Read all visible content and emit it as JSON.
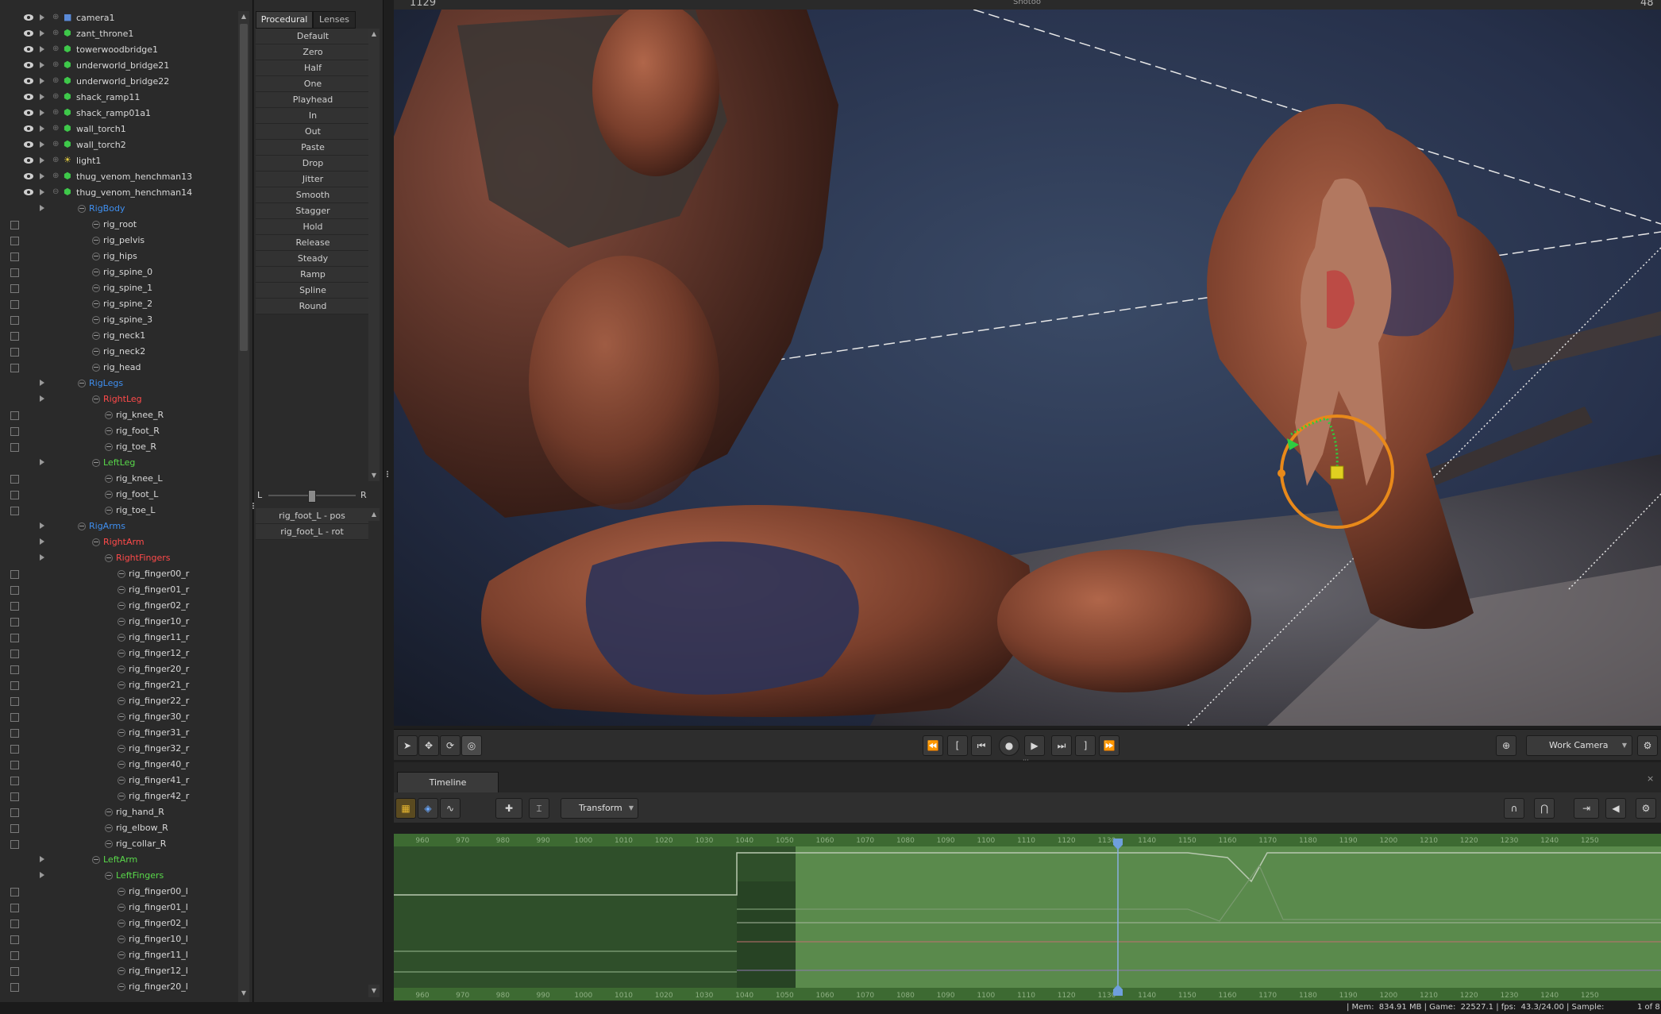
{
  "viewport": {
    "frame_left": "1129",
    "camera_name": "Shotoo",
    "frame_right": "48"
  },
  "outliner": {
    "rows": [
      {
        "label": "camera1",
        "kind": "camera",
        "indent": 0,
        "visible": true
      },
      {
        "label": "zant_throne1",
        "kind": "mesh",
        "indent": 0,
        "visible": true
      },
      {
        "label": "towerwoodbridge1",
        "kind": "mesh",
        "indent": 0,
        "visible": true
      },
      {
        "label": "underworld_bridge21",
        "kind": "mesh",
        "indent": 0,
        "visible": true
      },
      {
        "label": "underworld_bridge22",
        "kind": "mesh",
        "indent": 0,
        "visible": true
      },
      {
        "label": "shack_ramp11",
        "kind": "mesh",
        "indent": 0,
        "visible": true
      },
      {
        "label": "shack_ramp01a1",
        "kind": "mesh",
        "indent": 0,
        "visible": true
      },
      {
        "label": "wall_torch1",
        "kind": "mesh",
        "indent": 0,
        "visible": true
      },
      {
        "label": "wall_torch2",
        "kind": "mesh",
        "indent": 0,
        "visible": true
      },
      {
        "label": "light1",
        "kind": "light",
        "indent": 0,
        "visible": true
      },
      {
        "label": "thug_venom_henchman13",
        "kind": "mesh",
        "indent": 0,
        "visible": true
      },
      {
        "label": "thug_venom_henchman14",
        "kind": "mesh",
        "indent": 0,
        "visible": true,
        "expanded": true
      },
      {
        "label": "RigBody",
        "kind": "group",
        "color": "blue",
        "indent": 1,
        "arrow": true
      },
      {
        "label": "rig_root",
        "kind": "joint",
        "indent": 2,
        "check": true
      },
      {
        "label": "rig_pelvis",
        "kind": "joint",
        "indent": 2,
        "check": true
      },
      {
        "label": "rig_hips",
        "kind": "joint",
        "indent": 2,
        "check": true
      },
      {
        "label": "rig_spine_0",
        "kind": "joint",
        "indent": 2,
        "check": true
      },
      {
        "label": "rig_spine_1",
        "kind": "joint",
        "indent": 2,
        "check": true
      },
      {
        "label": "rig_spine_2",
        "kind": "joint",
        "indent": 2,
        "check": true
      },
      {
        "label": "rig_spine_3",
        "kind": "joint",
        "indent": 2,
        "check": true
      },
      {
        "label": "rig_neck1",
        "kind": "joint",
        "indent": 2,
        "check": true
      },
      {
        "label": "rig_neck2",
        "kind": "joint",
        "indent": 2,
        "check": true
      },
      {
        "label": "rig_head",
        "kind": "joint",
        "indent": 2,
        "check": true
      },
      {
        "label": "RigLegs",
        "kind": "group",
        "color": "blue",
        "indent": 1,
        "arrow": true
      },
      {
        "label": "RightLeg",
        "kind": "group",
        "color": "red",
        "indent": 2,
        "arrow": true
      },
      {
        "label": "rig_knee_R",
        "kind": "joint",
        "indent": 3,
        "check": true
      },
      {
        "label": "rig_foot_R",
        "kind": "joint",
        "indent": 3,
        "check": true
      },
      {
        "label": "rig_toe_R",
        "kind": "joint",
        "indent": 3,
        "check": true
      },
      {
        "label": "LeftLeg",
        "kind": "group",
        "color": "green",
        "indent": 2,
        "arrow": true
      },
      {
        "label": "rig_knee_L",
        "kind": "joint",
        "indent": 3,
        "check": true
      },
      {
        "label": "rig_foot_L",
        "kind": "joint",
        "indent": 3,
        "check": true
      },
      {
        "label": "rig_toe_L",
        "kind": "joint",
        "indent": 3,
        "check": true
      },
      {
        "label": "RigArms",
        "kind": "group",
        "color": "blue",
        "indent": 1,
        "arrow": true
      },
      {
        "label": "RightArm",
        "kind": "group",
        "color": "red",
        "indent": 2,
        "arrow": true
      },
      {
        "label": "RightFingers",
        "kind": "group",
        "color": "red",
        "indent": 3,
        "arrow": true
      },
      {
        "label": "rig_finger00_r",
        "kind": "joint",
        "indent": 4,
        "check": true
      },
      {
        "label": "rig_finger01_r",
        "kind": "joint",
        "indent": 4,
        "check": true
      },
      {
        "label": "rig_finger02_r",
        "kind": "joint",
        "indent": 4,
        "check": true
      },
      {
        "label": "rig_finger10_r",
        "kind": "joint",
        "indent": 4,
        "check": true
      },
      {
        "label": "rig_finger11_r",
        "kind": "joint",
        "indent": 4,
        "check": true
      },
      {
        "label": "rig_finger12_r",
        "kind": "joint",
        "indent": 4,
        "check": true
      },
      {
        "label": "rig_finger20_r",
        "kind": "joint",
        "indent": 4,
        "check": true
      },
      {
        "label": "rig_finger21_r",
        "kind": "joint",
        "indent": 4,
        "check": true
      },
      {
        "label": "rig_finger22_r",
        "kind": "joint",
        "indent": 4,
        "check": true
      },
      {
        "label": "rig_finger30_r",
        "kind": "joint",
        "indent": 4,
        "check": true
      },
      {
        "label": "rig_finger31_r",
        "kind": "joint",
        "indent": 4,
        "check": true
      },
      {
        "label": "rig_finger32_r",
        "kind": "joint",
        "indent": 4,
        "check": true
      },
      {
        "label": "rig_finger40_r",
        "kind": "joint",
        "indent": 4,
        "check": true
      },
      {
        "label": "rig_finger41_r",
        "kind": "joint",
        "indent": 4,
        "check": true
      },
      {
        "label": "rig_finger42_r",
        "kind": "joint",
        "indent": 4,
        "check": true
      },
      {
        "label": "rig_hand_R",
        "kind": "joint",
        "indent": 3,
        "check": true
      },
      {
        "label": "rig_elbow_R",
        "kind": "joint",
        "indent": 3,
        "check": true
      },
      {
        "label": "rig_collar_R",
        "kind": "joint",
        "indent": 3,
        "check": true
      },
      {
        "label": "LeftArm",
        "kind": "group",
        "color": "green",
        "indent": 2,
        "arrow": true
      },
      {
        "label": "LeftFingers",
        "kind": "group",
        "color": "green",
        "indent": 3,
        "arrow": true
      },
      {
        "label": "rig_finger00_l",
        "kind": "joint",
        "indent": 4,
        "check": true
      },
      {
        "label": "rig_finger01_l",
        "kind": "joint",
        "indent": 4,
        "check": true
      },
      {
        "label": "rig_finger02_l",
        "kind": "joint",
        "indent": 4,
        "check": true
      },
      {
        "label": "rig_finger10_l",
        "kind": "joint",
        "indent": 4,
        "check": true
      },
      {
        "label": "rig_finger11_l",
        "kind": "joint",
        "indent": 4,
        "check": true
      },
      {
        "label": "rig_finger12_l",
        "kind": "joint",
        "indent": 4,
        "check": true
      },
      {
        "label": "rig_finger20_l",
        "kind": "joint",
        "indent": 4,
        "check": true
      }
    ]
  },
  "procedural": {
    "tabs": [
      "Procedural",
      "Lenses"
    ],
    "items": [
      "Default",
      "Zero",
      "Half",
      "One",
      "Playhead",
      "In",
      "Out",
      "Paste",
      "Drop",
      "Jitter",
      "Smooth",
      "Stagger",
      "Hold",
      "Release",
      "Steady",
      "Ramp",
      "Spline",
      "Round"
    ],
    "slider_left": "L",
    "slider_right": "R",
    "keys": [
      "rig_foot_L - pos",
      "rig_foot_L - rot"
    ]
  },
  "transport": {
    "camera_select": "Work Camera"
  },
  "timeline": {
    "tab_label": "Timeline",
    "mode_select": "Transform",
    "ruler_ticks": [
      "960",
      "970",
      "980",
      "990",
      "1000",
      "1010",
      "1020",
      "1030",
      "1040",
      "1050",
      "1060",
      "1070",
      "1080",
      "1090",
      "1100",
      "1110",
      "1120",
      "1130",
      "1140",
      "1150",
      "1160",
      "1170",
      "1180",
      "1190",
      "1200",
      "1210",
      "1220",
      "1230",
      "1240",
      "1250"
    ],
    "playhead_frame": 1129
  },
  "status": {
    "text": "| Mem:  834.91 MB | Game:  22527.1 | fps:  43.3/24.00 | Sample:",
    "page": "1 of 8"
  },
  "colors": {
    "accent_orange": "#e8891a",
    "timeline_green": "#4e8a3e",
    "group_blue": "#3f8ff0",
    "group_red": "#ff4a4a",
    "group_green": "#59d94a"
  }
}
